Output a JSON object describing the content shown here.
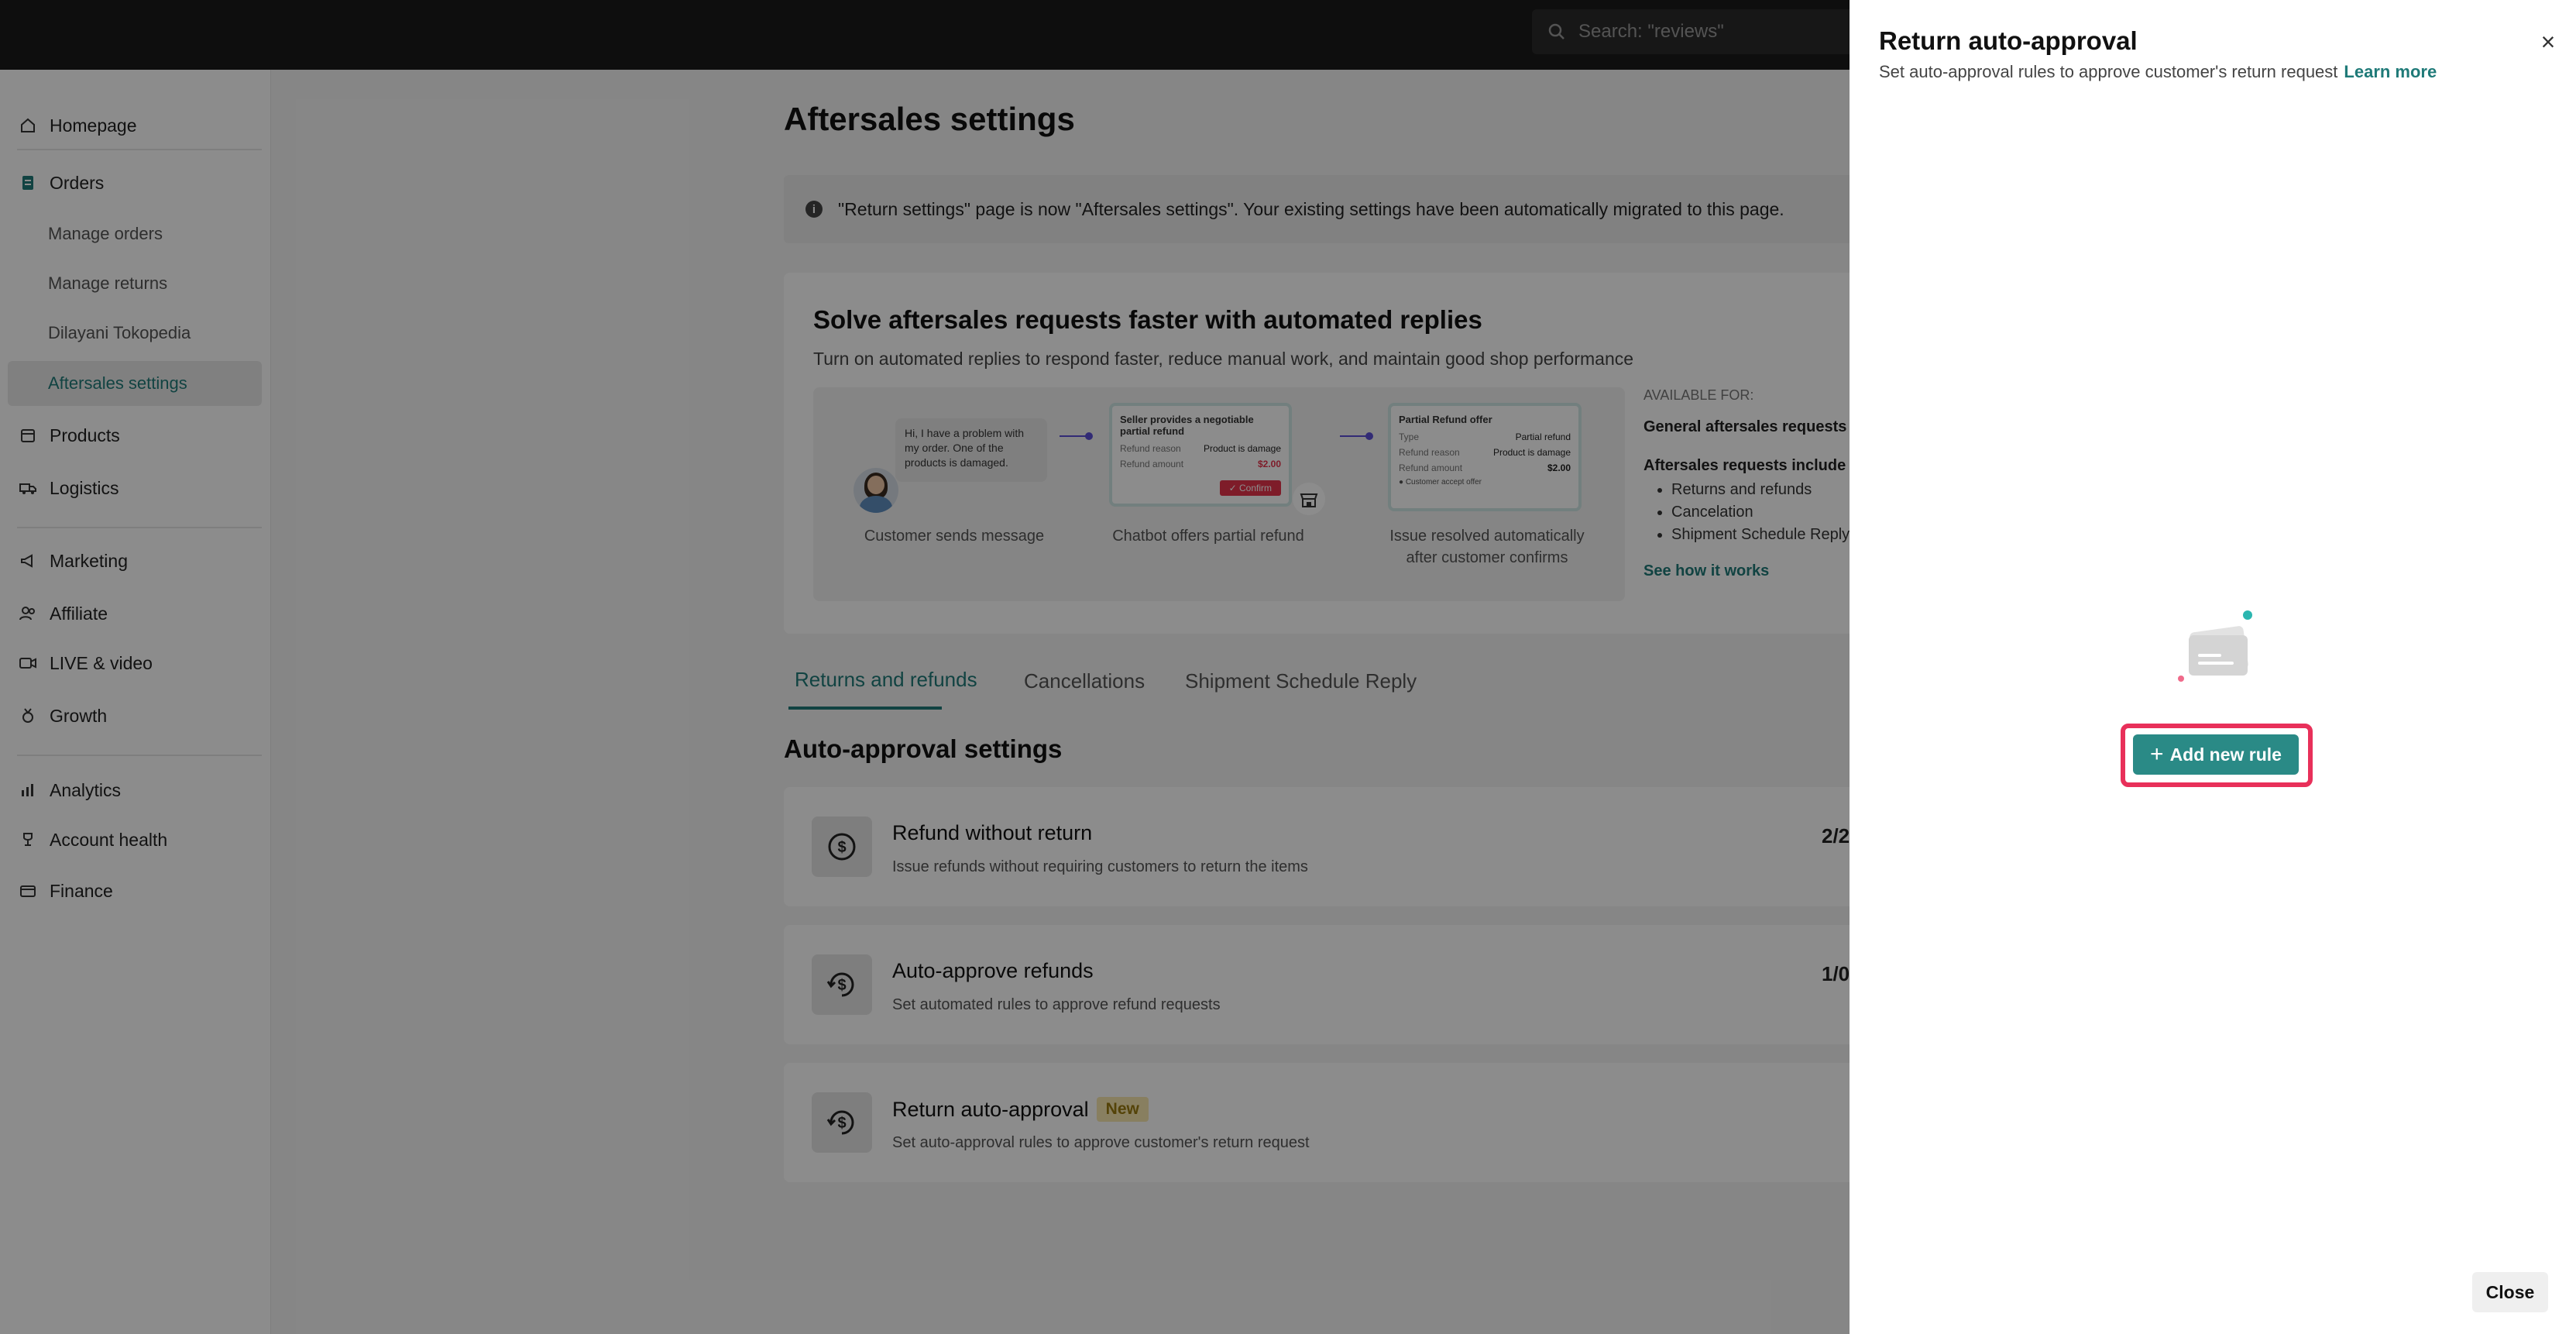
{
  "search": {
    "placeholder": "Search: \"reviews\""
  },
  "sidebar": {
    "items": [
      {
        "label": "Homepage",
        "icon": "home-icon"
      },
      {
        "label": "Orders",
        "icon": "orders-icon"
      },
      {
        "label": "Manage orders"
      },
      {
        "label": "Manage returns"
      },
      {
        "label": "Dilayani Tokopedia"
      },
      {
        "label": "Aftersales settings",
        "active": true
      },
      {
        "label": "Products",
        "icon": "box-icon"
      },
      {
        "label": "Logistics",
        "icon": "truck-icon"
      },
      {
        "label": "Marketing",
        "icon": "megaphone-icon"
      },
      {
        "label": "Affiliate",
        "icon": "people-icon"
      },
      {
        "label": "LIVE & video",
        "icon": "video-icon"
      },
      {
        "label": "Growth",
        "icon": "medal-icon"
      },
      {
        "label": "Analytics",
        "icon": "chart-icon"
      },
      {
        "label": "Account health",
        "icon": "trophy-icon"
      },
      {
        "label": "Finance",
        "icon": "wallet-icon"
      }
    ]
  },
  "main": {
    "title": "Aftersales settings",
    "banner": "\"Return settings\" page is now \"Aftersales settings\". Your existing settings have been automatically migrated to this page.",
    "promo": {
      "title": "Solve aftersales requests faster with automated replies",
      "subtitle": "Turn on automated replies to respond faster, reduce manual work, and maintain good shop performance",
      "bubble": "Hi, I have a problem with my order. One of the products is damaged.",
      "card1": {
        "title": "Seller provides a negotiable partial refund",
        "reason_label": "Refund reason",
        "reason_value": "Product is damage",
        "amount_label": "Refund amount",
        "amount_value": "$2.00",
        "confirm": "✓ Confirm"
      },
      "card2": {
        "title": "Partial Refund offer",
        "type_label": "Type",
        "type_value": "Partial refund",
        "reason_label": "Refund reason",
        "reason_value": "Product is damage",
        "amount_label": "Refund amount",
        "amount_value": "$2.00",
        "footer": "● Customer accept offer"
      },
      "captions": [
        "Customer sends message",
        "Chatbot offers partial refund",
        "Issue resolved automatically",
        "after customer confirms"
      ],
      "available_for": "AVAILABLE FOR:",
      "general": "General aftersales requests",
      "includes": "Aftersales requests include",
      "include_list": [
        "Returns and refunds",
        "Cancelation",
        "Shipment Schedule Reply"
      ],
      "see_how": "See how it works"
    },
    "tabs": [
      "Returns and refunds",
      "Cancellations",
      "Shipment Schedule Reply"
    ],
    "section_title": "Auto-approval settings",
    "settings": [
      {
        "name": "Refund without return",
        "desc": "Issue refunds without requiring customers to return the items",
        "count": "2/2"
      },
      {
        "name": "Auto-approve refunds",
        "desc": "Set automated rules to approve refund requests",
        "count": "1/0"
      },
      {
        "name": "Return auto-approval",
        "badge": "New",
        "desc": "Set auto-approval rules to approve customer's return request"
      }
    ]
  },
  "drawer": {
    "title": "Return auto-approval",
    "subtitle": "Set auto-approval rules to approve customer's return request",
    "learn_more": "Learn more",
    "add_rule": "Add new rule",
    "close": "Close",
    "highlight_color": "#e8305a",
    "accent": "#2a8a86"
  }
}
